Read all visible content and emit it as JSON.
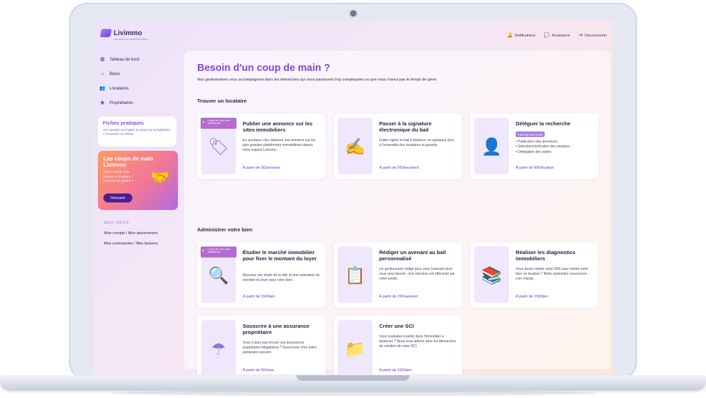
{
  "app": {
    "name": "Livimmo",
    "tagline": "LES SERVICES PROPRIÉTAIRES"
  },
  "header": {
    "notifications": {
      "icon": "bell-icon",
      "label": "Notifications"
    },
    "assistance": {
      "icon": "chat-icon",
      "label": "Assistance"
    },
    "logout": {
      "icon": "logout-icon",
      "label": "Déconnexion"
    }
  },
  "sidebar": {
    "items": [
      {
        "icon": "dashboard-icon",
        "label": "Tableau de bord"
      },
      {
        "icon": "home-icon",
        "label": "Biens"
      },
      {
        "icon": "users-icon",
        "label": "Locataires"
      },
      {
        "icon": "user-circle-icon",
        "label": "Propriétaires"
      }
    ],
    "fiches": {
      "title": "Fiches pratiques",
      "text": "Une question sur l'appli, un doute sur la législation ? Consultez nos fiches."
    },
    "promo": {
      "title": "Les coups de main Livimmo",
      "text": "Besoin d'aide pour trouver un locataire ? Un souci de gestion ?",
      "button": "Découvrir"
    },
    "infos": {
      "title": "MES INFOS",
      "links": [
        "Mon compte / Mon abonnement",
        "Mes commandes / Mes factures"
      ]
    }
  },
  "main": {
    "title": "Besoin d'un coup de main ?",
    "subtitle": "Nos gestionnaires vous accompagnent dans les démarches qui vous paraissent trop compliquées ou que vous n'avez pas le temps de gérer.",
    "badge": "Coup de cœur des utilisateurs",
    "sections": [
      {
        "title": "Trouver un locataire",
        "cards": [
          {
            "title": "Publier une annonce sur les sites immobiliers",
            "desc": "En quelques clics déposez une annonce sur les plus grandes plateformes immobilières depuis votre espace Livimmo.",
            "price": "À partir de 5€/annonce",
            "badge": true,
            "icon": "listing-sites-icon"
          },
          {
            "title": "Passer à la signature électronique du bail",
            "desc": "Faites signer le bail à distance, en quelques clics, à l'ensemble des locataires et garants.",
            "price": "À partir de 5€/document",
            "icon": "e-signature-icon"
          },
          {
            "title": "Déléguer la recherche",
            "package": "Package tout inclus",
            "list": [
              "Publication des annonces",
              "Sélection/vérification des dossiers",
              "Délégation des visites"
            ],
            "price": "À partir de 50€/location",
            "icon": "delegate-search-icon"
          }
        ]
      },
      {
        "title": "Administrer votre bien",
        "cards": [
          {
            "title": "Étudier le marché immobilier pour fixer le montant du loyer",
            "desc": "Recevez une étude de la ville et une estimation du montant du loyer pour votre bien.",
            "price": "À partir de 15€/bien",
            "badge": true,
            "icon": "market-study-icon"
          },
          {
            "title": "Rédiger un avenant au bail personnalisé",
            "desc": "Un gestionnaire rédige pour vous l'avenant dont vous avez besoin. Une relecture est effectuée par notre juriste.",
            "price": "À partir de 15€/avenant",
            "icon": "contract-icon"
          },
          {
            "title": "Réaliser les diagnostics immobiliers",
            "desc": "Vous devez refaire votre DPE pour mettre votre bien en location ? Notre partenaire xxxxxxxxxx s'en charge.",
            "price": "À partir de 15€/bien",
            "icon": "diagnostics-icon"
          },
          {
            "title": "Souscrire à une assurance propriétaire",
            "desc": "Vous n'avez pas encore vos assurances propriétaire obligatoires ? Souscrivez chez notre partenaire xxxxxxx.",
            "price": "À partir de 5€/mois",
            "icon": "umbrella-icon"
          },
          {
            "title": "Créer une SCI",
            "desc": "Vous souhaitez investir dans l'immobilier à plusieurs ? Nous vous aidons dans les démarches de création de votre SCI.",
            "price": "À partir de 15€/bien",
            "icon": "sci-folder-icon"
          }
        ]
      }
    ]
  }
}
